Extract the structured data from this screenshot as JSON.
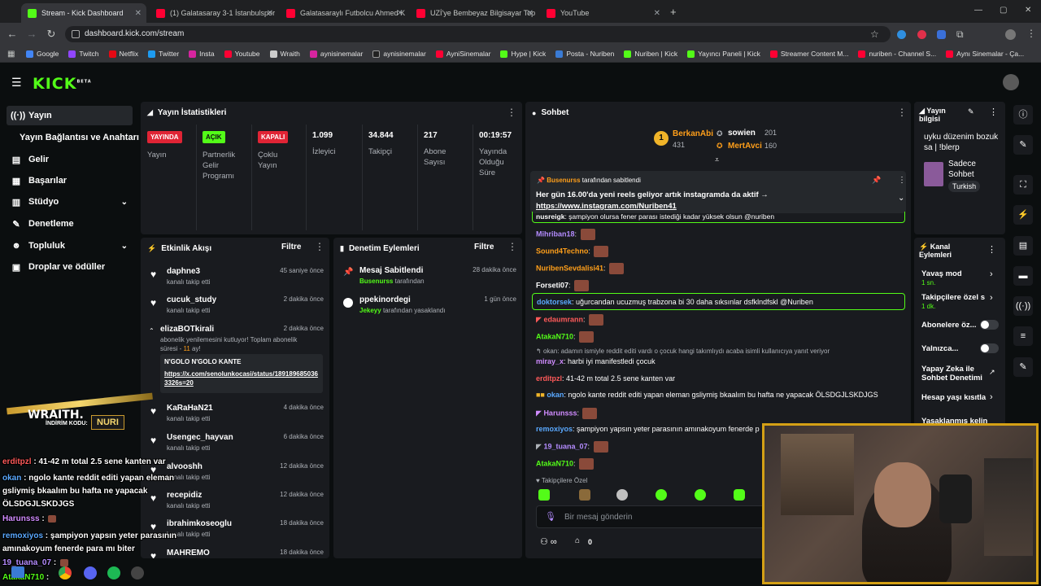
{
  "browser": {
    "tabs": [
      "Stream - Kick Dashboard",
      "(1) Galatasaray 3-1 İstanbulspor",
      "Galatasaraylı Futbolcu Ahmed K",
      "UZİ'ye Bembeyaz Bilgisayar Top",
      "YouTube"
    ],
    "url": "dashboard.kick.com/stream",
    "bookmarks": [
      "Google",
      "Twitch",
      "Netflix",
      "Twitter",
      "Insta",
      "Youtube",
      "Wraith",
      "aynisinemalar",
      "aynisinemalar",
      "AyniSinemalar",
      "Hype | Kick",
      "Posta - Nuriben",
      "Nuriben | Kick",
      "Yayıncı Paneli | Kick",
      "Streamer Content M...",
      "nuriben - Channel S...",
      "Aynı Sinemalar - Ça..."
    ]
  },
  "header": {
    "logo": "KICK",
    "beta": "BETA"
  },
  "sidebar": {
    "items": [
      {
        "label": "Yayın",
        "icon": "broadcast-icon"
      },
      {
        "label": "Yayın Bağlantısı ve Anahtarı",
        "icon": ""
      },
      {
        "label": "Gelir",
        "icon": "revenue-icon"
      },
      {
        "label": "Başarılar",
        "icon": "achievements-icon"
      },
      {
        "label": "Stüdyo",
        "icon": "studio-icon"
      },
      {
        "label": "Denetleme",
        "icon": "wrench-icon"
      },
      {
        "label": "Topluluk",
        "icon": "community-icon"
      },
      {
        "label": "Droplar ve ödüller",
        "icon": "gift-icon"
      }
    ]
  },
  "stats": {
    "title": "Yayın İstatistikleri",
    "badges": [
      {
        "text": "YAYINDA",
        "label": "Yayın"
      },
      {
        "text": "AÇIK",
        "label": "Partnerlik Gelir Programı"
      },
      {
        "text": "KAPALI",
        "label": "Çoklu Yayın"
      }
    ],
    "numbers": [
      {
        "value": "1.099",
        "label": "İzleyici"
      },
      {
        "value": "34.844",
        "label": "Takipçi"
      },
      {
        "value": "217",
        "label": "Abone Sayısı"
      },
      {
        "value": "00:19:57",
        "label": "Yayında Olduğu Süre"
      }
    ]
  },
  "activity": {
    "title": "Etkinlik Akışı",
    "filter": "Filtre",
    "items": [
      {
        "name": "daphne3",
        "sub": "kanalı takip etti",
        "time": "45 saniye önce"
      },
      {
        "name": "cucuk_study",
        "sub": "kanalı takip etti",
        "time": "2 dakika önce"
      },
      {
        "name": "elizaBOTkirali",
        "sub": "abonelik yenilemesini kutluyor! Toplam abonelik süresi -",
        "months": "11",
        "months_suffix": "ay!",
        "time": "2 dakika önce",
        "quote_title": "N'GOLO N'GOLO KANTE",
        "quote_link": "https://x.com/senolunkocasi/status/1891896850363326s=20"
      },
      {
        "name": "KaRaHaN21",
        "sub": "kanalı takip etti",
        "time": "4 dakika önce"
      },
      {
        "name": "Usengec_hayvan",
        "sub": "kanalı takip etti",
        "time": "6 dakika önce"
      },
      {
        "name": "alvooshh",
        "sub": "kanalı takip etti",
        "time": "12 dakika önce"
      },
      {
        "name": "recepidiz",
        "sub": "kanalı takip etti",
        "time": "12 dakika önce"
      },
      {
        "name": "ibrahimkoseoglu",
        "sub": "kanalı takip etti",
        "time": "18 dakika önce"
      },
      {
        "name": "MAHREMO",
        "sub": "",
        "time": "18 dakika önce"
      }
    ]
  },
  "moderation": {
    "title": "Denetim Eylemleri",
    "filter": "Filtre",
    "items": [
      {
        "name": "Mesaj Sabitlendi",
        "actor": "Busenurss",
        "sub": "tarafından",
        "time": "28 dakika önce"
      },
      {
        "name": "ppekinordegi",
        "actor": "Jekeyy",
        "sub": "tarafından yasaklandı",
        "time": "1 gün önce"
      }
    ]
  },
  "chat": {
    "title": "Sohbet",
    "leaders": [
      {
        "name": "BerkanAbi",
        "count": "431"
      },
      {
        "name": "sowien",
        "count": "201"
      },
      {
        "name": "MertAvci",
        "count": "160"
      }
    ],
    "pinned": {
      "by": "Busenurss",
      "by_suffix": "tarafından sabitlendi",
      "text": "Her gün 16.00'da yeni reels geliyor artık instagramda da aktif →",
      "link": "https://www.instagram.com/Nuriben41"
    },
    "messages": [
      {
        "user": "nusreigk",
        "text": "şampiyon olursa fener parası istediği kadar yüksek olsun @nuriben",
        "color": "#ffffff"
      },
      {
        "user": "Mihriban18",
        "text": "",
        "color": "#b48cff"
      },
      {
        "user": "Sound4Techno",
        "text": "",
        "color": "#ff9f1a"
      },
      {
        "user": "NuribenSevdalisi41",
        "text": "",
        "color": "#ff9f1a"
      },
      {
        "user": "Forseti07",
        "text": "",
        "color": "#ffffff"
      },
      {
        "user": "doktorsek",
        "text": "uğurcandan ucuzmuş trabzona bi 30 daha sıksınlar dsfklndfskl @Nuriben",
        "color": "#5aa9ff"
      },
      {
        "user": "edaumrann",
        "text": "",
        "color": "#ff5a5a"
      },
      {
        "user": "AtakaN710",
        "text": "",
        "color": "#53fc18"
      },
      {
        "user": "okan",
        "text": "adamın ismiyle reddit editi vardı o çocuk hangi takımlıydı acaba isimli kullanıcıya yanıt veriyor",
        "color": "#aeb2b8",
        "reply": true
      },
      {
        "user": "miray_x",
        "text": "harbi iyi manifestledi çocuk",
        "color": "#d08cff"
      },
      {
        "user": "erditpzl",
        "text": "41-42 m total 2.5 sene kanten var",
        "color": "#ff5a5a"
      },
      {
        "user": "okan",
        "text": "ngolo kante reddit editi yapan eleman gsliymiş bkaalım bu hafta ne yapacak ÖLSDGJLSKDJGS",
        "color": "#5aa9ff"
      },
      {
        "user": "Harunsss",
        "text": "",
        "color": "#d08cff"
      },
      {
        "user": "remoxiyos",
        "text": "şampiyon yapsın yeter parasının amınakoyum fenerde p",
        "color": "#5aa9ff"
      },
      {
        "user": "19_tuana_07",
        "text": "",
        "color": "#b48cff"
      },
      {
        "user": "AtakaN710",
        "text": "",
        "color": "#53fc18"
      }
    ],
    "followers_only": "Takipçilere Özel",
    "input_placeholder": "Bir mesaj gönderin",
    "points": "0"
  },
  "info": {
    "title": "Yayın bilgisi",
    "stream_title": "uyku düzenim bozuk sa | !blerp",
    "category": "Sadece Sohbet",
    "language": "Turkish"
  },
  "channel_actions": {
    "title": "Kanal Eylemleri",
    "items": [
      {
        "label": "Yavaş mod",
        "value": "1 sn."
      },
      {
        "label": "Takipçilere özel s",
        "value": "1 dk."
      },
      {
        "label": "Abonelere öz..."
      },
      {
        "label": "Yalnızca..."
      },
      {
        "label": "Yapay Zeka ile Sohbet Denetimi"
      },
      {
        "label": "Hesap yaşı kısıtla"
      },
      {
        "label": "Yasaklanmış kelin"
      }
    ]
  },
  "overlay": {
    "brand": "WRAITH.",
    "code_label": "İNDİRİM KODU:",
    "code": "NURI",
    "lines": [
      {
        "user": "erditpzl",
        "text": "41-42 m total 2.5 sene kanten var"
      },
      {
        "user": "okan",
        "text": "ngolo kante reddit editi yapan eleman gsliymiş bkaalım bu hafta ne yapacak ÖLSDGJLSKDJGS"
      },
      {
        "user": "Harunsss",
        "text": ""
      },
      {
        "user": "remoxiyos",
        "text": "şampiyon yapsın yeter parasının amınakoyum fenerde para mı biter"
      },
      {
        "user": "19_tuana_07",
        "text": ""
      },
      {
        "user": "AtakaN710",
        "text": ""
      }
    ]
  }
}
